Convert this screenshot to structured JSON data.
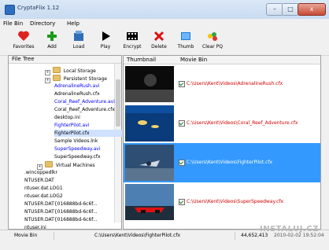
{
  "window": {
    "title": "CryptaFlix 1.12",
    "controls": {
      "min": "–",
      "max": "□",
      "close": "x"
    }
  },
  "menu": {
    "items": [
      "File",
      "Bin",
      "Directory",
      "Help"
    ]
  },
  "toolbar": {
    "buttons": [
      {
        "label": "Favorites",
        "icon": "favorites-icon"
      },
      {
        "label": "Add",
        "icon": "add-icon"
      },
      {
        "label": "Load",
        "icon": "load-icon"
      },
      {
        "label": "Play",
        "icon": "play-icon"
      },
      {
        "label": "Encrypt",
        "icon": "encrypt-icon"
      },
      {
        "label": "Delete",
        "icon": "delete-icon"
      },
      {
        "label": "Thumb",
        "icon": "thumb-icon"
      },
      {
        "label": "Clear PQ",
        "icon": "clear-pq-icon"
      }
    ]
  },
  "file_tree": {
    "header": "File Tree",
    "items": [
      {
        "text": "Local Storage",
        "type": "folder"
      },
      {
        "text": "Persistent Storage",
        "type": "folder"
      },
      {
        "text": "AdrenalineRush.avi",
        "type": "file",
        "blue": true
      },
      {
        "text": "AdrenalineRush.cfx",
        "type": "file"
      },
      {
        "text": "Coral_Reef_Adventure.avi",
        "type": "file",
        "blue": true
      },
      {
        "text": "Coral_Reef_Adventure.cfx",
        "type": "file"
      },
      {
        "text": "desktop.ini",
        "type": "file"
      },
      {
        "text": "FighterPilot.avi",
        "type": "file",
        "blue": true
      },
      {
        "text": "FighterPilot.cfx",
        "type": "file"
      },
      {
        "text": "Sample Videos.lnk",
        "type": "file"
      },
      {
        "text": "SuperSpeedway.avi",
        "type": "file",
        "blue": true
      },
      {
        "text": "SuperSpeedway.cfx",
        "type": "file"
      },
      {
        "text": "Virtual Machines",
        "type": "folder"
      },
      {
        "text": ".wincoppedlkr",
        "type": "file"
      },
      {
        "text": "NTUSER.DAT",
        "type": "file"
      },
      {
        "text": "ntuser.dat.LOG1",
        "type": "file"
      },
      {
        "text": "ntuser.dat.LOG2",
        "type": "file"
      },
      {
        "text": "NTUSER.DAT{016888bd-6c6f...",
        "type": "file"
      },
      {
        "text": "NTUSER.DAT{016888bd-6c6f...",
        "type": "file"
      },
      {
        "text": "NTUSER.DAT{016888bd-6c6f...",
        "type": "file"
      },
      {
        "text": "ntuser.ini",
        "type": "file"
      }
    ]
  },
  "movie_bin": {
    "headers": {
      "thumbnail": "Thumbnail",
      "bin": "Movie Bin"
    },
    "rows": [
      {
        "path": "C:\\Users\\Kent\\Videos\\AdrenalineRush.cfx"
      },
      {
        "path": "C:\\Users\\Kent\\Videos\\Coral_Reef_Adventure.cfx"
      },
      {
        "path": "C:\\Users\\Kent\\Videos\\FighterPilot.cfx"
      },
      {
        "path": "C:\\Users\\Kent\\Videos\\SuperSpeedway.cfx"
      }
    ]
  },
  "status": {
    "left": "Movie Bin",
    "path": "C:\\Users\\Kent\\Videos\\FighterPilot.cfx",
    "size": "44,652,413",
    "date": "2010-02-02 19:52:04"
  },
  "watermark": "INSTALUJ.CZ",
  "colors": {
    "selected_row": "#3399ff",
    "path_text": "#d10000",
    "blue_file": "#0000ff"
  }
}
